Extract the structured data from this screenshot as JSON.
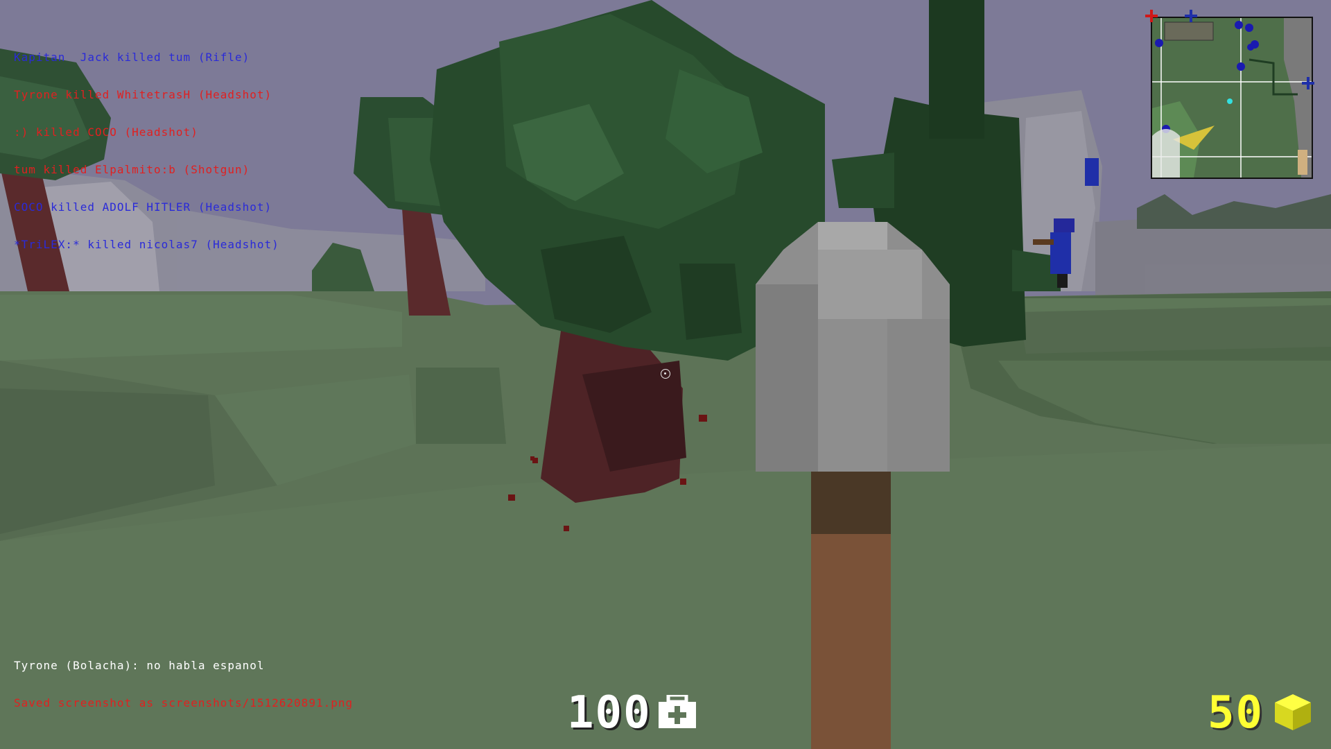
{
  "killfeed": [
    {
      "text": "Kapitan  Jack killed tum (Rifle)",
      "color": "#2a2ad8"
    },
    {
      "text": "Tyrone killed WhitetrasH (Headshot)",
      "color": "#e02020"
    },
    {
      "text": ":) killed COCO (Headshot)",
      "color": "#e02020"
    },
    {
      "text": "tum killed Elpalmito:b (Shotgun)",
      "color": "#e02020"
    },
    {
      "text": "COCO killed ADOLF HITLER (Headshot)",
      "color": "#2a2ad8"
    },
    {
      "text": "*TriLEX:* killed nicolas7 (Headshot)",
      "color": "#2a2ad8"
    }
  ],
  "chat": [
    {
      "text": "Tyrone (Bolacha): no habla espanol",
      "color": "#ffffff"
    },
    {
      "text": "Saved screenshot as screenshots/1512620891.png",
      "color": "#e02020"
    }
  ],
  "hud": {
    "health": "100",
    "health_icon": "medkit-icon",
    "ammo": "50",
    "ammo_icon": "block-icon",
    "health_color": "#ffffff",
    "ammo_color": "#ffff33"
  },
  "colors": {
    "sky": "#7d7a97",
    "grass": "#5d7357",
    "leaves": "#2f5a36",
    "trunk": "#5a2a2c",
    "stone": "#8a8a8a",
    "team_blue": "#1f2fa8",
    "team_red": "#d01818"
  }
}
